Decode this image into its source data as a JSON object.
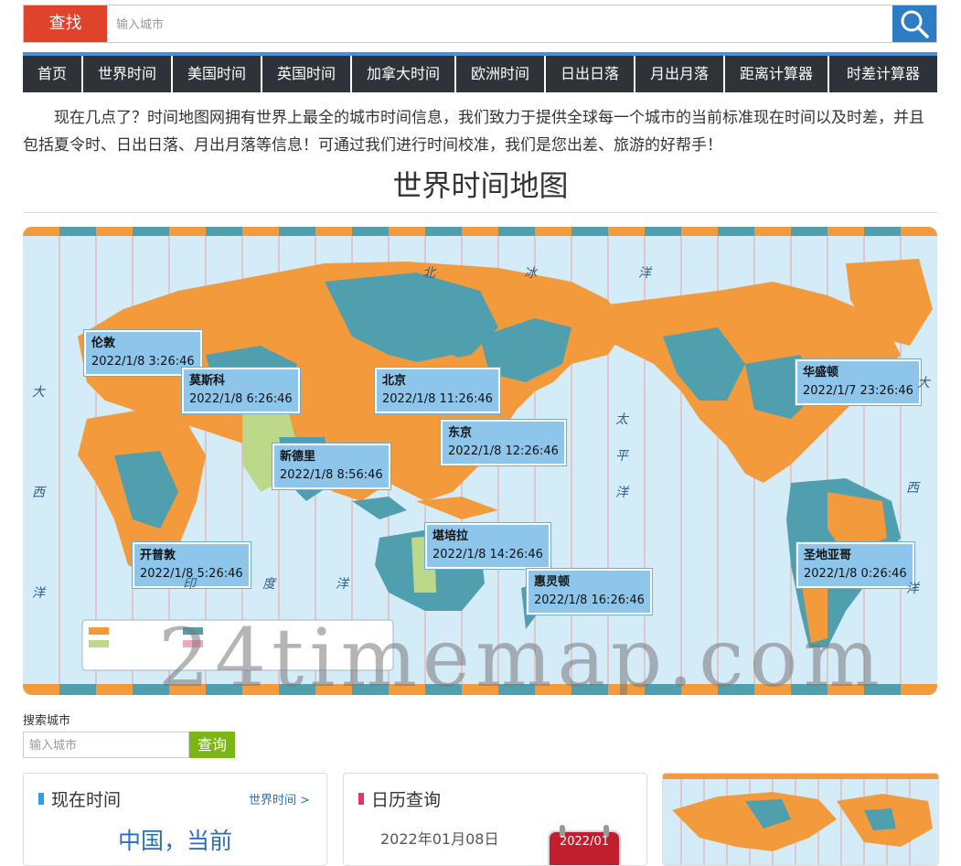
{
  "search": {
    "label": "查找",
    "placeholder": "输入城市"
  },
  "nav": {
    "items": [
      "首页",
      "世界时间",
      "美国时间",
      "英国时间",
      "加拿大时间",
      "欧洲时间",
      "日出日落",
      "月出月落",
      "距离计算器",
      "时差计算器"
    ]
  },
  "intro": "现在几点了？时间地图网拥有世界上最全的城市时间信息，我们致力于提供全球每一个城市的当前标准现在时间以及时差，并且包括夏令时、日出日落、月出月落等信息！可通过我们进行时间校准，我们是您出差、旅游的好帮手！",
  "page_title": "世界时间地图",
  "map": {
    "watermark": "24timemap.com",
    "clocks": [
      {
        "city": "伦敦",
        "time": "2022/1/8 3:26:46"
      },
      {
        "city": "莫斯科",
        "time": "2022/1/8 6:26:46"
      },
      {
        "city": "北京",
        "time": "2022/1/8 11:26:46"
      },
      {
        "city": "东京",
        "time": "2022/1/8 12:26:46"
      },
      {
        "city": "新德里",
        "time": "2022/1/8 8:56:46"
      },
      {
        "city": "华盛顿",
        "time": "2022/1/7 23:26:46"
      },
      {
        "city": "开普敦",
        "time": "2022/1/8 5:26:46"
      },
      {
        "city": "堪培拉",
        "time": "2022/1/8 14:26:46"
      },
      {
        "city": "惠灵顿",
        "time": "2022/1/8 16:26:46"
      },
      {
        "city": "圣地亚哥",
        "time": "2022/1/8 0:26:46"
      }
    ],
    "ocean_labels": [
      "北",
      "冰",
      "洋",
      "大",
      "西",
      "洋",
      "太",
      "平",
      "洋",
      "印",
      "度",
      "洋",
      "大",
      "西",
      "洋"
    ],
    "colors": {
      "ocean": "#cfe9f6",
      "land_orange": "#f39a3c",
      "land_teal": "#4f9fae",
      "land_green": "#bcd98a"
    }
  },
  "search_city": {
    "label": "搜索城市",
    "placeholder": "输入城市",
    "button": "查询"
  },
  "cards": {
    "now": {
      "title": "现在时间",
      "link": "世界时间 >",
      "headline": "中国，当前"
    },
    "calendar": {
      "title": "日历查询",
      "date": "2022年01月08日",
      "badge": "2022/01"
    }
  },
  "colors": {
    "search_red": "#e0432c",
    "search_blue": "#2d7cc4",
    "nav_bg": "#2e3239",
    "nav_accent": "#4a90d9",
    "go_green": "#7cb518",
    "link_blue": "#2d6fb8"
  }
}
